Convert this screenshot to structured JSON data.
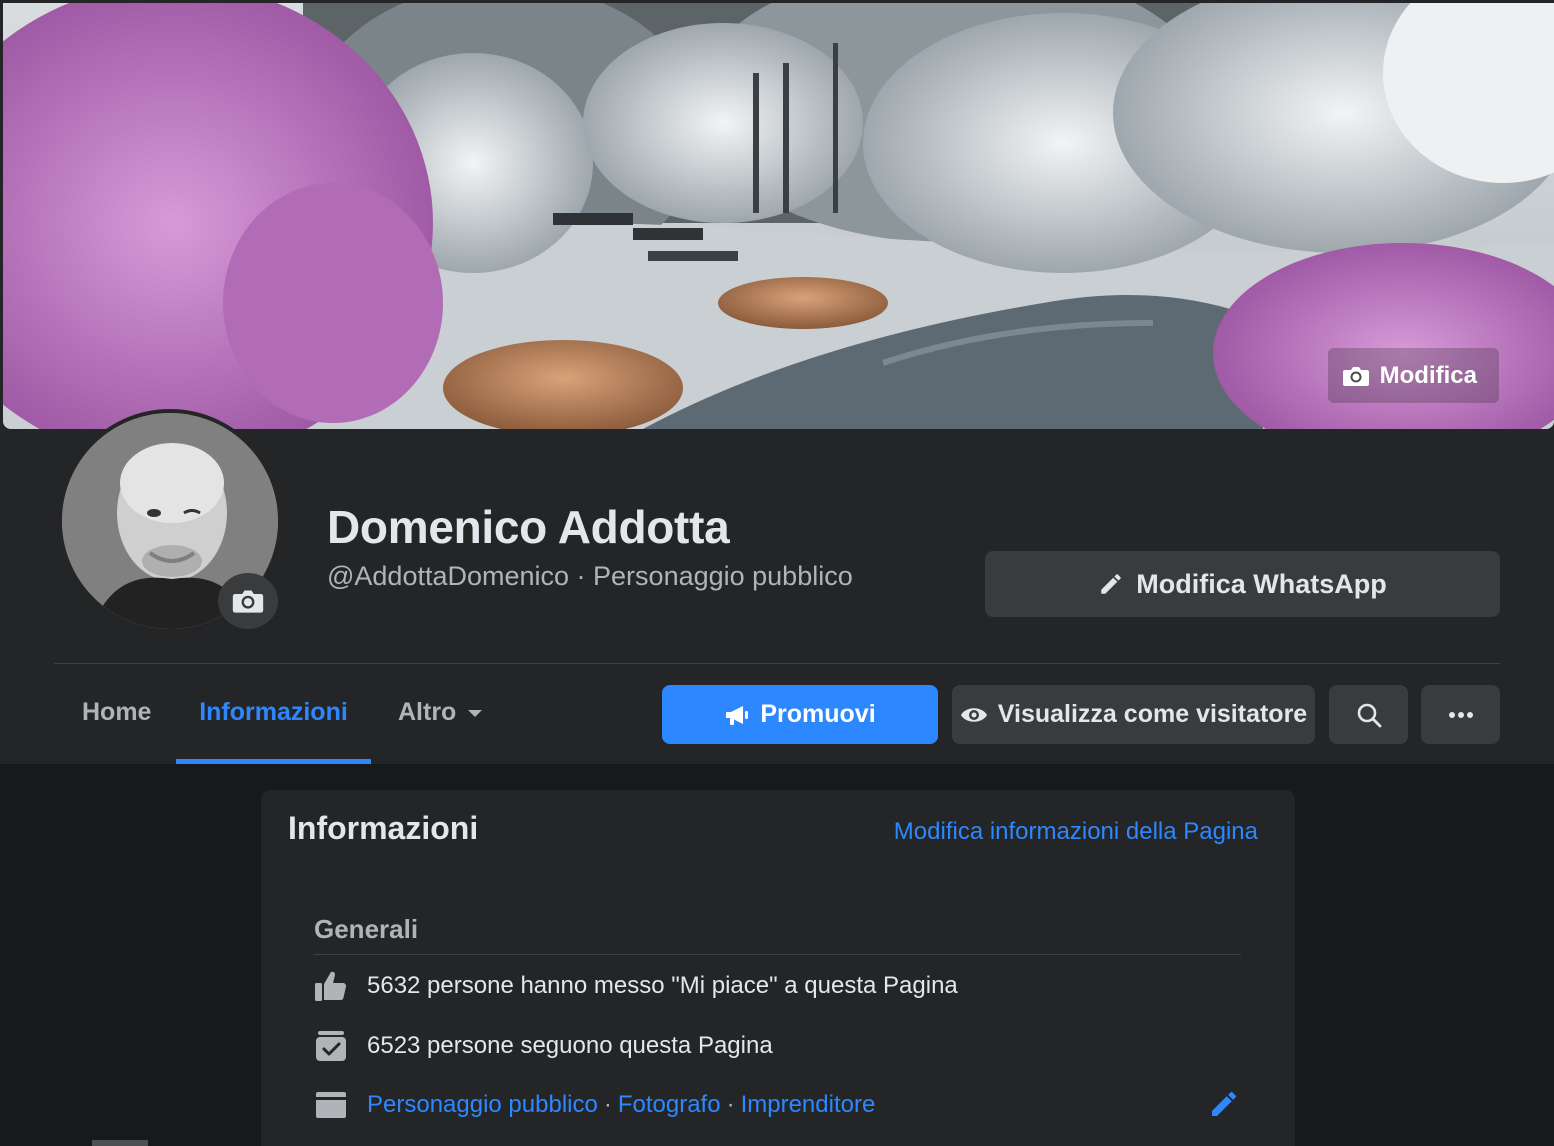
{
  "cover": {
    "edit_label": "Modifica",
    "edit_icon": "camera-icon"
  },
  "profile": {
    "name": "Domenico Addotta",
    "subline": "@AddottaDomenico · Personaggio pubblico",
    "avatar_camera_icon": "camera-icon"
  },
  "actions": {
    "whatsapp_label": "Modifica WhatsApp",
    "whatsapp_icon": "pencil-icon"
  },
  "tabs": [
    {
      "label": "Home",
      "active": false
    },
    {
      "label": "Informazioni",
      "active": true
    },
    {
      "label": "Altro",
      "active": false
    }
  ],
  "toolbar": {
    "promote_label": "Promuovi",
    "promote_icon": "megaphone-icon",
    "visitor_label": "Visualizza come visitatore",
    "visitor_icon": "eye-icon",
    "search_icon": "search-icon",
    "more_icon": "more-icon"
  },
  "info": {
    "title": "Informazioni",
    "edit_link": "Modifica informazioni della Pagina",
    "section_title": "Generali",
    "likes_text": "5632 persone hanno messo \"Mi piace\" a questa Pagina",
    "followers_text": "6523 persone seguono questa Pagina",
    "categories": [
      "Personaggio pubblico",
      "Fotografo",
      "Imprenditore"
    ]
  },
  "colors": {
    "background": "#18191a",
    "surface": "#242526",
    "button": "#3a3b3c",
    "accent": "#2d88ff",
    "text_primary": "#e4e6eb",
    "text_secondary": "#b0b3b8"
  }
}
